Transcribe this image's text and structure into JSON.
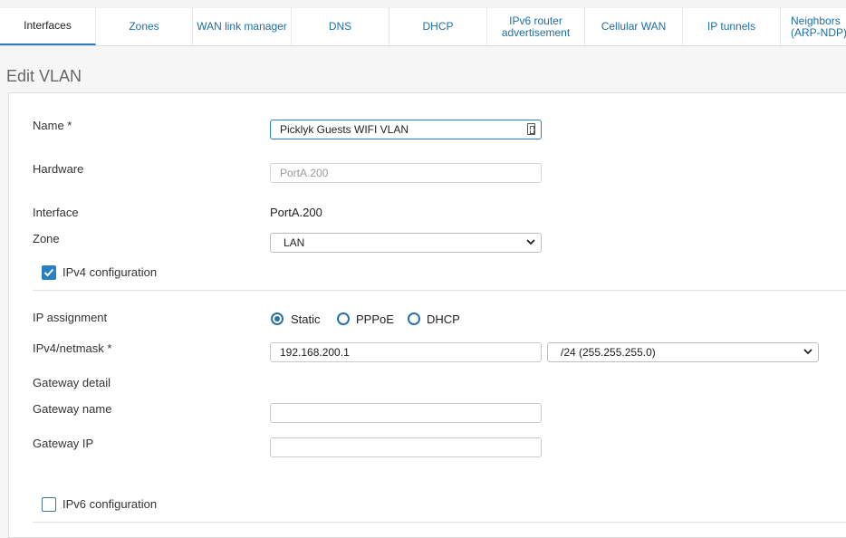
{
  "tabs": [
    {
      "label": "Interfaces",
      "active": true
    },
    {
      "label": "Zones"
    },
    {
      "label": "WAN link manager"
    },
    {
      "label": "DNS"
    },
    {
      "label": "DHCP"
    },
    {
      "label": "IPv6 router advertisement"
    },
    {
      "label": "Cellular WAN"
    },
    {
      "label": "IP tunnels"
    },
    {
      "label": "Neighbors (ARP-NDP)"
    }
  ],
  "page": {
    "title": "Edit VLAN"
  },
  "form": {
    "name_label": "Name *",
    "name_value": "Picklyk Guests WIFI VLAN",
    "hardware_label": "Hardware",
    "hardware_value": "PortA.200",
    "interface_label": "Interface",
    "interface_value": "PortA.200",
    "zone_label": "Zone",
    "zone_value": "LAN",
    "ipv4_config_label": "IPv4 configuration",
    "ipv4_config_checked": true,
    "ip_assignment_label": "IP assignment",
    "ip_assignment_options": [
      "Static",
      "PPPoE",
      "DHCP"
    ],
    "ip_assignment_selected": "Static",
    "netmask_label": "IPv4/netmask *",
    "ipv4_value": "192.168.200.1",
    "netmask_value": "/24 (255.255.255.0)",
    "gateway_detail_label": "Gateway detail",
    "gateway_name_label": "Gateway name",
    "gateway_name_value": "",
    "gateway_ip_label": "Gateway IP",
    "gateway_ip_value": "",
    "ipv6_config_label": "IPv6 configuration",
    "ipv6_config_checked": false
  },
  "colors": {
    "accent": "#2a7fc0",
    "link": "#1d6fa5"
  }
}
